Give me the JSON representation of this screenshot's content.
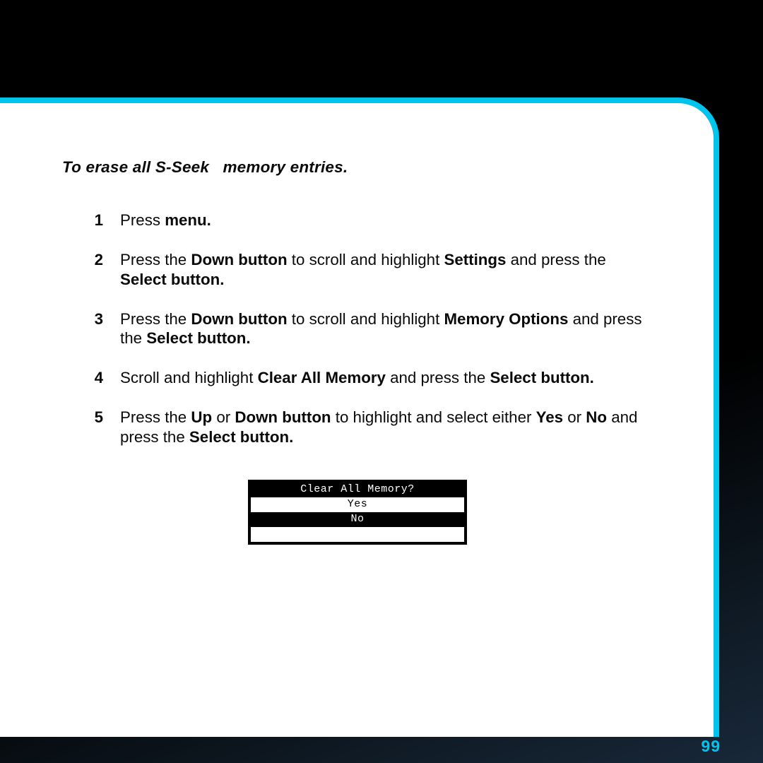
{
  "heading_prefix": "To erase all S-Seek",
  "heading_suffix": " memory entries.",
  "steps": [
    {
      "n": "1",
      "segs": [
        [
          "Press "
        ],
        [
          "menu.",
          "b"
        ]
      ]
    },
    {
      "n": "2",
      "segs": [
        [
          "Press the "
        ],
        [
          "Down button",
          "b"
        ],
        [
          " to scroll and highlight "
        ],
        [
          "Settings",
          "b"
        ],
        [
          " and press the "
        ],
        [
          "Select button.",
          "b"
        ]
      ]
    },
    {
      "n": "3",
      "segs": [
        [
          "Press the "
        ],
        [
          "Down button",
          "b"
        ],
        [
          " to scroll and highlight "
        ],
        [
          "Memory Options",
          "b"
        ],
        [
          " and press the "
        ],
        [
          "Select button.",
          "b"
        ]
      ]
    },
    {
      "n": "4",
      "segs": [
        [
          "Scroll and highlight "
        ],
        [
          "Clear All Memory",
          "b"
        ],
        [
          " and press the "
        ],
        [
          "Select button.",
          "b"
        ]
      ]
    },
    {
      "n": "5",
      "segs": [
        [
          "Press the "
        ],
        [
          "Up",
          "b"
        ],
        [
          " or "
        ],
        [
          "Down button",
          "b"
        ],
        [
          " to highlight and select either "
        ],
        [
          "Yes",
          "b"
        ],
        [
          " or "
        ],
        [
          "No",
          "b"
        ],
        [
          " and press the "
        ],
        [
          "Select button.",
          "b"
        ]
      ]
    }
  ],
  "lcd": {
    "title": "Clear All Memory?",
    "options": [
      "Yes",
      "No"
    ],
    "selected": 1
  },
  "page_number": "99"
}
